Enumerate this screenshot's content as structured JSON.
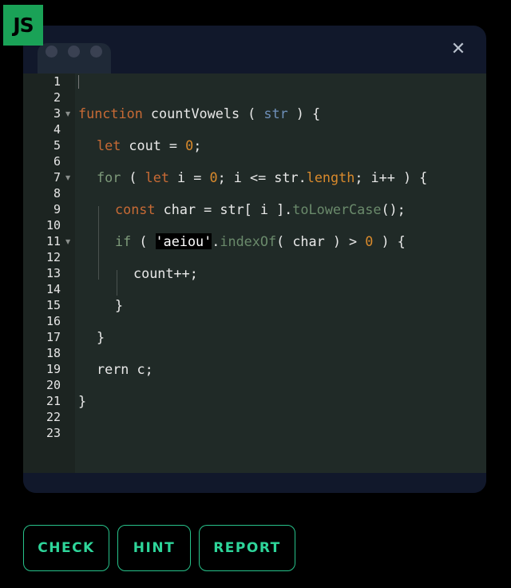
{
  "badge": {
    "label": "JS"
  },
  "window": {
    "close_glyph": "✕"
  },
  "editor": {
    "line_numbers": [
      "1",
      "2",
      "3",
      "4",
      "5",
      "6",
      "7",
      "8",
      "9",
      "10",
      "11",
      "12",
      "13",
      "14",
      "15",
      "16",
      "17",
      "18",
      "19",
      "20",
      "21",
      "22",
      "23"
    ],
    "code": {
      "l3": {
        "kw": "function",
        "name": " countVowels ( ",
        "param": "str",
        "rest": " ) {"
      },
      "l5": {
        "kw": "let",
        "a": " cout = ",
        "num": "0",
        "b": ";"
      },
      "l7": {
        "kw": "for",
        "a": " ( ",
        "kw2": "let",
        "b": " i = ",
        "num": "0",
        "c": "; i <= str.",
        "prop": "length",
        "d": "; i++ ) {"
      },
      "l9": {
        "kw": "const",
        "a": " char = str[ i ].",
        "method": "toLowerCase",
        "b": "();"
      },
      "l11": {
        "kw": "if",
        "a": " ( ",
        "str": "'aeiou'",
        "b": ".",
        "method": "indexOf",
        "c": "( char ) > ",
        "num": "0",
        "d": " ) {"
      },
      "l13": {
        "text": "count++;"
      },
      "l15": {
        "text": "}"
      },
      "l17": {
        "text": "}"
      },
      "l19": {
        "text": "rern c;"
      },
      "l21": {
        "text": "}"
      }
    }
  },
  "buttons": {
    "check": "CHECK",
    "hint": "HINT",
    "report": "REPORT"
  },
  "colors": {
    "accent": "#2ed59a",
    "badge": "#1aa257",
    "keyword": "#c76a35",
    "number": "#d98a2c"
  }
}
